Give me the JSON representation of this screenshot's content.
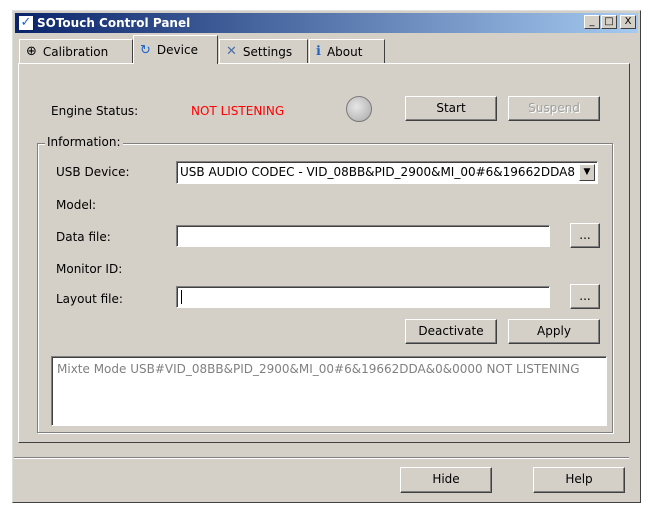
{
  "window": {
    "title": "SOTouch Control Panel",
    "icon": "sotouch-check-icon",
    "minimize": "_",
    "maximize": "□",
    "close": "X"
  },
  "tabs": [
    {
      "label": "Calibration",
      "icon": "crosshair-icon",
      "glyph": "⊕"
    },
    {
      "label": "Device",
      "icon": "refresh-icon",
      "glyph": "↻",
      "active": true
    },
    {
      "label": "Settings",
      "icon": "tools-icon",
      "glyph": "✕"
    },
    {
      "label": "About",
      "icon": "info-icon",
      "glyph": "ℹ"
    }
  ],
  "engine": {
    "label": "Engine Status:",
    "status": "NOT LISTENING",
    "status_color": "#ff0000",
    "start_label": "Start",
    "suspend_label": "Suspend"
  },
  "info": {
    "legend": "Information:",
    "usb_label": "USB Device:",
    "usb_value": "USB AUDIO CODEC - VID_08BB&PID_2900&MI_00#6&19662DDA8",
    "model_label": "Model:",
    "datafile_label": "Data file:",
    "datafile_value": "",
    "monitor_label": "Monitor ID:",
    "layout_label": "Layout file:",
    "layout_value": "",
    "browse_label": "...",
    "deactivate_label": "Deactivate",
    "apply_label": "Apply",
    "log": "Mixte Mode USB#VID_08BB&PID_2900&MI_00#6&19662DDA&0&0000 NOT LISTENING"
  },
  "footer": {
    "hide_label": "Hide",
    "help_label": "Help"
  }
}
